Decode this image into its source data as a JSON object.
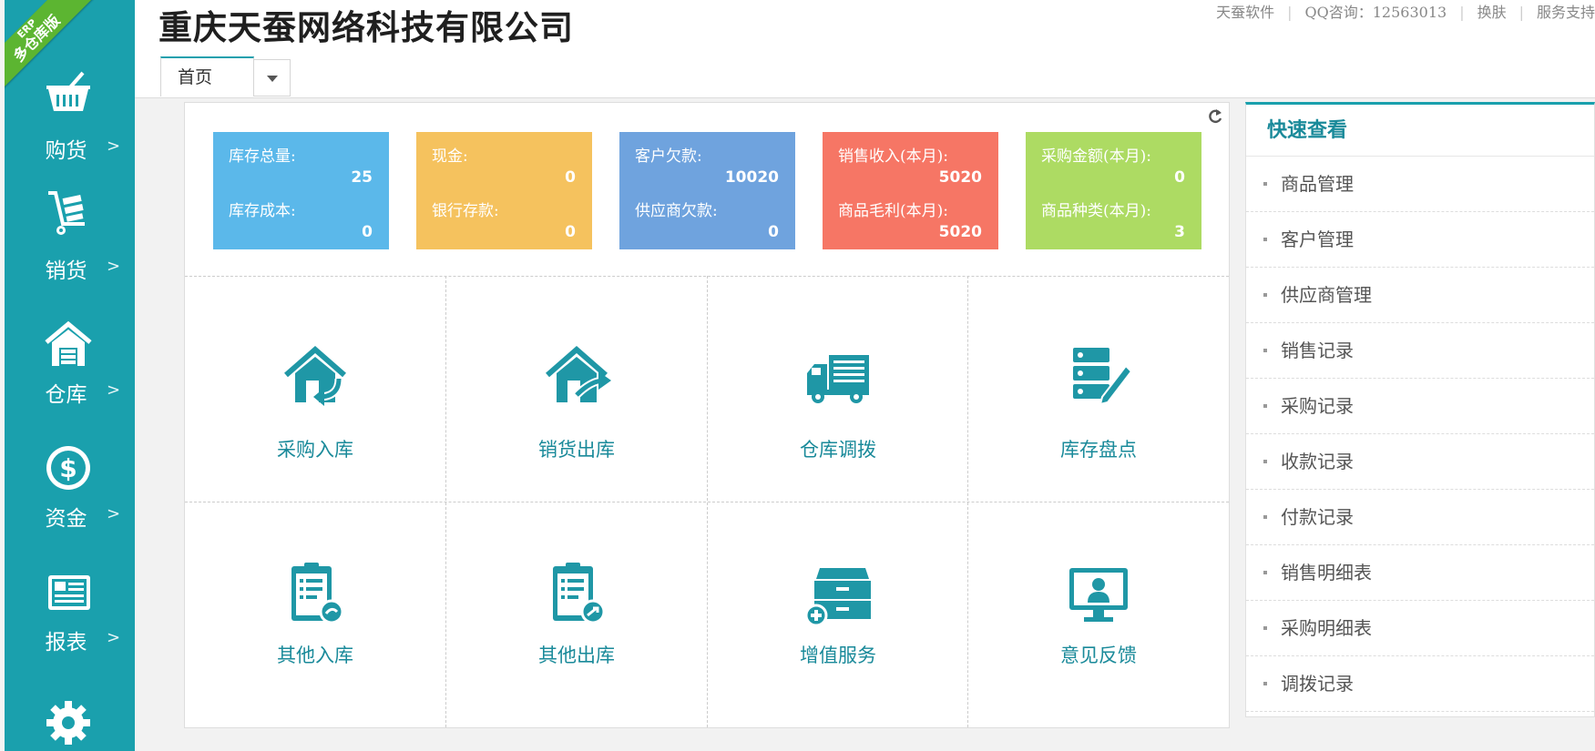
{
  "brand": {
    "ribbon_small": "ERP",
    "ribbon_main": "多仓库版"
  },
  "sidebar": {
    "items": [
      {
        "label": "购货",
        "arrow": ">",
        "icon": "basket-icon"
      },
      {
        "label": "销货",
        "arrow": ">",
        "icon": "cart-dolly-icon"
      },
      {
        "label": "仓库",
        "arrow": ">",
        "icon": "warehouse-icon"
      },
      {
        "label": "资金",
        "arrow": ">",
        "icon": "dollar-circle-icon"
      },
      {
        "label": "报表",
        "arrow": ">",
        "icon": "report-icon"
      }
    ],
    "settings_icon": "gear-icon"
  },
  "header": {
    "company": "重庆天蚕网络科技有限公司",
    "links": [
      "天蚕软件",
      "QQ咨询：12563013",
      "换肤",
      "服务支持"
    ],
    "tab_home": "首页"
  },
  "stats": [
    {
      "label1": "库存总量:",
      "value1": "25",
      "label2": "库存成本:",
      "value2": "0",
      "color": "#5bb8ea"
    },
    {
      "label1": "现金:",
      "value1": "0",
      "label2": "银行存款:",
      "value2": "0",
      "color": "#f5c25e"
    },
    {
      "label1": "客户欠款:",
      "value1": "10020",
      "label2": "供应商欠款:",
      "value2": "0",
      "color": "#6fa3de"
    },
    {
      "label1": "销售收入(本月):",
      "value1": "5020",
      "label2": "商品毛利(本月):",
      "value2": "5020",
      "color": "#f67665"
    },
    {
      "label1": "采购金额(本月):",
      "value1": "0",
      "label2": "商品种类(本月):",
      "value2": "3",
      "color": "#addb63"
    }
  ],
  "grid": [
    {
      "label": "采购入库",
      "icon": "house-in-icon"
    },
    {
      "label": "销货出库",
      "icon": "house-out-icon"
    },
    {
      "label": "仓库调拨",
      "icon": "truck-icon"
    },
    {
      "label": "库存盘点",
      "icon": "inventory-edit-icon"
    },
    {
      "label": "其他入库",
      "icon": "clipboard-in-icon"
    },
    {
      "label": "其他出库",
      "icon": "clipboard-out-icon"
    },
    {
      "label": "增值服务",
      "icon": "drawer-add-icon"
    },
    {
      "label": "意见反馈",
      "icon": "monitor-user-icon"
    }
  ],
  "quick": {
    "title": "快速查看",
    "items": [
      "商品管理",
      "客户管理",
      "供应商管理",
      "销售记录",
      "采购记录",
      "收款记录",
      "付款记录",
      "销售明细表",
      "采购明细表",
      "调拨记录"
    ]
  },
  "colors": {
    "accent": "#1aa0ad",
    "grid_text": "#1a8a9a",
    "icon": "#1f97a6"
  }
}
